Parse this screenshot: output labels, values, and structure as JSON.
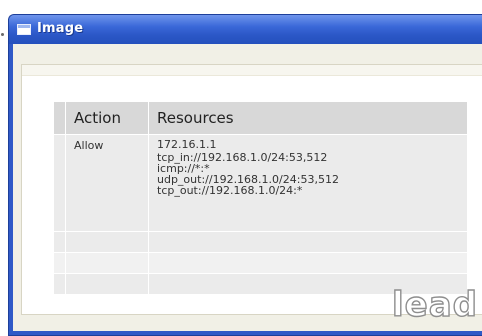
{
  "window": {
    "title": "Image"
  },
  "table": {
    "headers": {
      "action": "Action",
      "resources": "Resources"
    },
    "rows": [
      {
        "action": "Allow",
        "resources": [
          "172.16.1.1",
          "tcp_in://192.168.1.0/24:53,512",
          "icmp://*:*",
          "udp_out://192.168.1.0/24:53,512",
          "tcp_out://192.168.1.0/24:*"
        ]
      }
    ]
  },
  "watermark": {
    "text": "lead"
  },
  "colors": {
    "titlebar": "#2f59c7",
    "header_cell": "#d8d8d8",
    "body_cell": "#ebebeb"
  }
}
